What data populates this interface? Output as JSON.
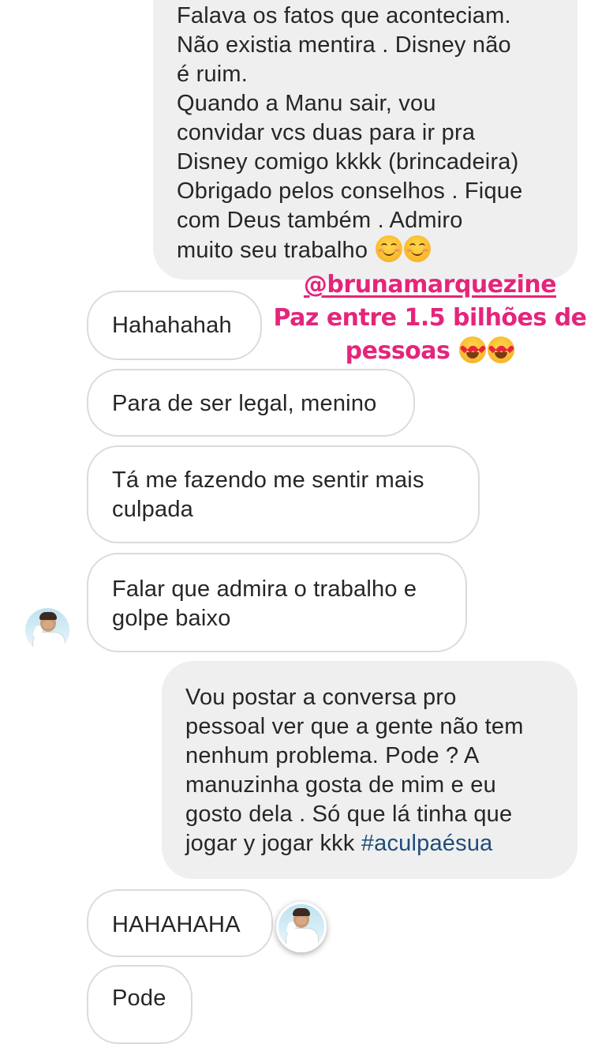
{
  "messages": {
    "sent_1": {
      "lines": [
        "Falava os fatos que aconteciam.",
        "Não existia mentira .  Disney não",
        "é  ruim.",
        "Quando a Manu sair, vou",
        "convidar vcs duas para ir pra",
        "Disney comigo kkkk (brincadeira)",
        "Obrigado pelos conselhos . Fique",
        "com Deus também . Admiro",
        "muito seu trabalho"
      ],
      "emoji": "smiling-face-with-smiling-eyes-icon"
    },
    "recv_1": {
      "lines": [
        "Hahahahah"
      ]
    },
    "recv_2": {
      "lines": [
        "Para de ser legal, menino"
      ]
    },
    "recv_3": {
      "lines": [
        "Tá me fazendo me sentir mais",
        "culpada"
      ]
    },
    "recv_4": {
      "lines": [
        "Falar que admira o trabalho e",
        "golpe baixo"
      ]
    },
    "sent_2": {
      "lines": [
        "Vou postar a conversa pro",
        "pessoal ver que a gente não tem",
        "nenhum problema. Pode ? A",
        "manuzinha  gosta de mim e eu",
        "gosto dela . Só que lá tinha que",
        "jogar y jogar kkk"
      ],
      "hashtag": "#aculpaésua"
    },
    "recv_5": {
      "lines": [
        "HAHAHAHA"
      ]
    },
    "recv_6": {
      "lines": [
        "Pode"
      ]
    }
  },
  "sticker": {
    "mention": "@brunamarquezine",
    "line2": "Paz entre 1.5 bilhões de",
    "line3": "pessoas",
    "emoji": "heart-eyes-icon",
    "color": "#e4257b"
  },
  "avatars": {
    "contact_avatar": "avatar-icon",
    "read_receipt_avatar": "avatar-icon"
  },
  "colors": {
    "sent_bubble": "#efefef",
    "received_border": "#dbdbdb",
    "text": "#262626",
    "hashtag": "#1f4c7a"
  }
}
